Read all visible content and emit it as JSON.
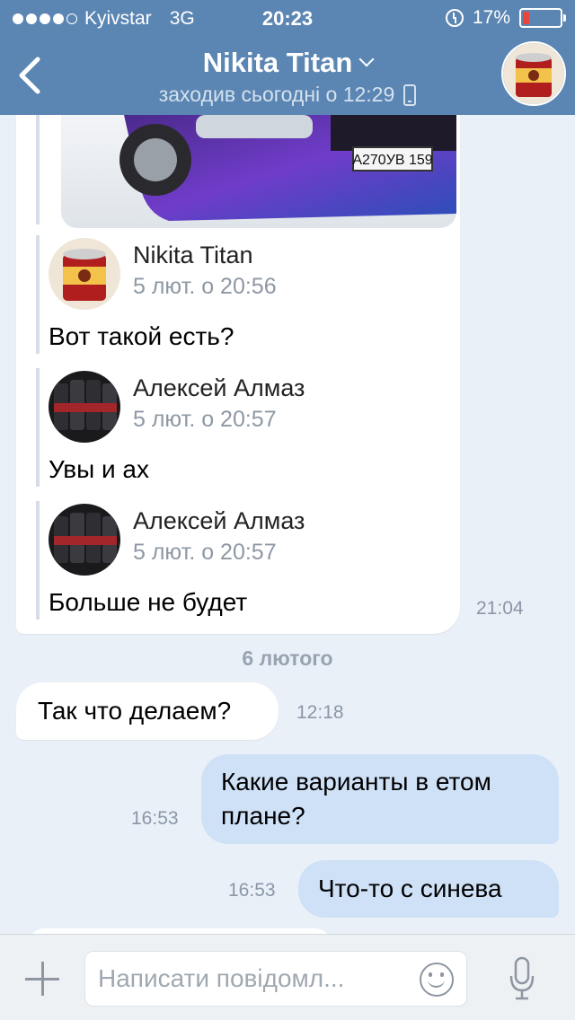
{
  "status_bar": {
    "carrier": "Kyivstar",
    "network": "3G",
    "time": "20:23",
    "battery_percent_label": "17%",
    "battery_level": 0.17,
    "signal_bars": 4,
    "alarm_icon": "alarm-clock-icon"
  },
  "header": {
    "title": "Nikita Titan",
    "subtitle": "заходив сьогодні о 12:29",
    "back_icon": "chevron-left-icon",
    "dropdown_icon": "chevron-down-icon",
    "device_icon": "phone-icon",
    "avatar_icon": "paint-can-avatar"
  },
  "messages": {
    "forward_bubble": {
      "photo_plate": "А270УВ 159",
      "forwards": [
        {
          "name": "Nikita Titan",
          "date": "5 лют. о 20:56",
          "text": "Вот такой есть?"
        },
        {
          "name": "Алексей Алмаз",
          "date": "5 лют. о 20:57",
          "text": "Увы и ах"
        },
        {
          "name": "Алексей Алмаз",
          "date": "5 лют. о 20:57",
          "text": "Больше не будет"
        }
      ],
      "time": "21:04"
    },
    "day_separator": "6 лютого",
    "incoming_1": {
      "text": "Так что делаем?",
      "time": "12:18"
    },
    "outgoing_1": {
      "line1": "Какие варианты в етом",
      "line2": "плане?",
      "time": "16:53"
    },
    "outgoing_2": {
      "text": "Что-то с синева",
      "time": "16:53"
    }
  },
  "composer": {
    "placeholder": "Написати повідомл...",
    "attach_icon": "plus-icon",
    "emoji_icon": "smile-icon",
    "mic_icon": "microphone-icon"
  },
  "colors": {
    "header_bg": "#5b86b3",
    "chat_bg": "#eaf0f7",
    "bubble_in": "#ffffff",
    "bubble_out": "#cfe1f7",
    "battery_low": "#e8453c"
  }
}
